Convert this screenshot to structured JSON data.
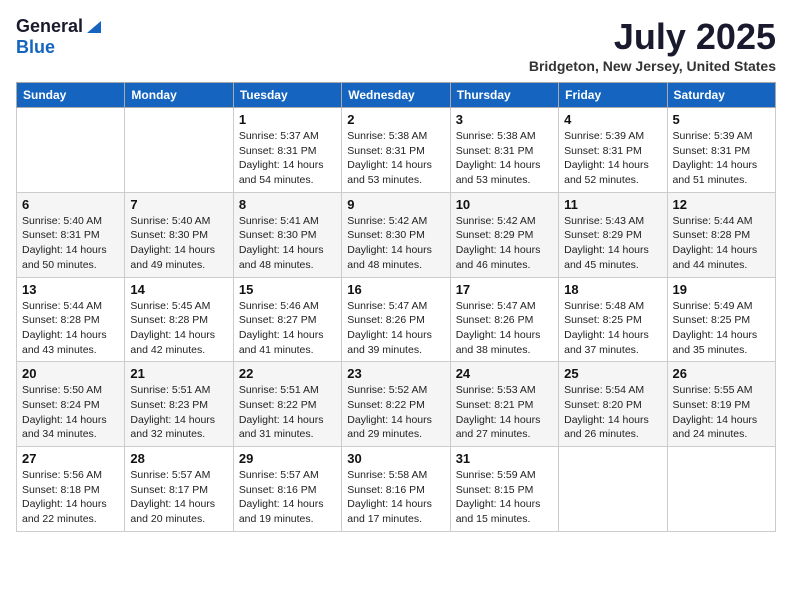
{
  "header": {
    "logo_general": "General",
    "logo_blue": "Blue",
    "title": "July 2025",
    "location": "Bridgeton, New Jersey, United States"
  },
  "weekdays": [
    "Sunday",
    "Monday",
    "Tuesday",
    "Wednesday",
    "Thursday",
    "Friday",
    "Saturday"
  ],
  "weeks": [
    [
      {
        "day": "",
        "sunrise": "",
        "sunset": "",
        "daylight": ""
      },
      {
        "day": "",
        "sunrise": "",
        "sunset": "",
        "daylight": ""
      },
      {
        "day": "1",
        "sunrise": "Sunrise: 5:37 AM",
        "sunset": "Sunset: 8:31 PM",
        "daylight": "Daylight: 14 hours and 54 minutes."
      },
      {
        "day": "2",
        "sunrise": "Sunrise: 5:38 AM",
        "sunset": "Sunset: 8:31 PM",
        "daylight": "Daylight: 14 hours and 53 minutes."
      },
      {
        "day": "3",
        "sunrise": "Sunrise: 5:38 AM",
        "sunset": "Sunset: 8:31 PM",
        "daylight": "Daylight: 14 hours and 53 minutes."
      },
      {
        "day": "4",
        "sunrise": "Sunrise: 5:39 AM",
        "sunset": "Sunset: 8:31 PM",
        "daylight": "Daylight: 14 hours and 52 minutes."
      },
      {
        "day": "5",
        "sunrise": "Sunrise: 5:39 AM",
        "sunset": "Sunset: 8:31 PM",
        "daylight": "Daylight: 14 hours and 51 minutes."
      }
    ],
    [
      {
        "day": "6",
        "sunrise": "Sunrise: 5:40 AM",
        "sunset": "Sunset: 8:31 PM",
        "daylight": "Daylight: 14 hours and 50 minutes."
      },
      {
        "day": "7",
        "sunrise": "Sunrise: 5:40 AM",
        "sunset": "Sunset: 8:30 PM",
        "daylight": "Daylight: 14 hours and 49 minutes."
      },
      {
        "day": "8",
        "sunrise": "Sunrise: 5:41 AM",
        "sunset": "Sunset: 8:30 PM",
        "daylight": "Daylight: 14 hours and 48 minutes."
      },
      {
        "day": "9",
        "sunrise": "Sunrise: 5:42 AM",
        "sunset": "Sunset: 8:30 PM",
        "daylight": "Daylight: 14 hours and 48 minutes."
      },
      {
        "day": "10",
        "sunrise": "Sunrise: 5:42 AM",
        "sunset": "Sunset: 8:29 PM",
        "daylight": "Daylight: 14 hours and 46 minutes."
      },
      {
        "day": "11",
        "sunrise": "Sunrise: 5:43 AM",
        "sunset": "Sunset: 8:29 PM",
        "daylight": "Daylight: 14 hours and 45 minutes."
      },
      {
        "day": "12",
        "sunrise": "Sunrise: 5:44 AM",
        "sunset": "Sunset: 8:28 PM",
        "daylight": "Daylight: 14 hours and 44 minutes."
      }
    ],
    [
      {
        "day": "13",
        "sunrise": "Sunrise: 5:44 AM",
        "sunset": "Sunset: 8:28 PM",
        "daylight": "Daylight: 14 hours and 43 minutes."
      },
      {
        "day": "14",
        "sunrise": "Sunrise: 5:45 AM",
        "sunset": "Sunset: 8:28 PM",
        "daylight": "Daylight: 14 hours and 42 minutes."
      },
      {
        "day": "15",
        "sunrise": "Sunrise: 5:46 AM",
        "sunset": "Sunset: 8:27 PM",
        "daylight": "Daylight: 14 hours and 41 minutes."
      },
      {
        "day": "16",
        "sunrise": "Sunrise: 5:47 AM",
        "sunset": "Sunset: 8:26 PM",
        "daylight": "Daylight: 14 hours and 39 minutes."
      },
      {
        "day": "17",
        "sunrise": "Sunrise: 5:47 AM",
        "sunset": "Sunset: 8:26 PM",
        "daylight": "Daylight: 14 hours and 38 minutes."
      },
      {
        "day": "18",
        "sunrise": "Sunrise: 5:48 AM",
        "sunset": "Sunset: 8:25 PM",
        "daylight": "Daylight: 14 hours and 37 minutes."
      },
      {
        "day": "19",
        "sunrise": "Sunrise: 5:49 AM",
        "sunset": "Sunset: 8:25 PM",
        "daylight": "Daylight: 14 hours and 35 minutes."
      }
    ],
    [
      {
        "day": "20",
        "sunrise": "Sunrise: 5:50 AM",
        "sunset": "Sunset: 8:24 PM",
        "daylight": "Daylight: 14 hours and 34 minutes."
      },
      {
        "day": "21",
        "sunrise": "Sunrise: 5:51 AM",
        "sunset": "Sunset: 8:23 PM",
        "daylight": "Daylight: 14 hours and 32 minutes."
      },
      {
        "day": "22",
        "sunrise": "Sunrise: 5:51 AM",
        "sunset": "Sunset: 8:22 PM",
        "daylight": "Daylight: 14 hours and 31 minutes."
      },
      {
        "day": "23",
        "sunrise": "Sunrise: 5:52 AM",
        "sunset": "Sunset: 8:22 PM",
        "daylight": "Daylight: 14 hours and 29 minutes."
      },
      {
        "day": "24",
        "sunrise": "Sunrise: 5:53 AM",
        "sunset": "Sunset: 8:21 PM",
        "daylight": "Daylight: 14 hours and 27 minutes."
      },
      {
        "day": "25",
        "sunrise": "Sunrise: 5:54 AM",
        "sunset": "Sunset: 8:20 PM",
        "daylight": "Daylight: 14 hours and 26 minutes."
      },
      {
        "day": "26",
        "sunrise": "Sunrise: 5:55 AM",
        "sunset": "Sunset: 8:19 PM",
        "daylight": "Daylight: 14 hours and 24 minutes."
      }
    ],
    [
      {
        "day": "27",
        "sunrise": "Sunrise: 5:56 AM",
        "sunset": "Sunset: 8:18 PM",
        "daylight": "Daylight: 14 hours and 22 minutes."
      },
      {
        "day": "28",
        "sunrise": "Sunrise: 5:57 AM",
        "sunset": "Sunset: 8:17 PM",
        "daylight": "Daylight: 14 hours and 20 minutes."
      },
      {
        "day": "29",
        "sunrise": "Sunrise: 5:57 AM",
        "sunset": "Sunset: 8:16 PM",
        "daylight": "Daylight: 14 hours and 19 minutes."
      },
      {
        "day": "30",
        "sunrise": "Sunrise: 5:58 AM",
        "sunset": "Sunset: 8:16 PM",
        "daylight": "Daylight: 14 hours and 17 minutes."
      },
      {
        "day": "31",
        "sunrise": "Sunrise: 5:59 AM",
        "sunset": "Sunset: 8:15 PM",
        "daylight": "Daylight: 14 hours and 15 minutes."
      },
      {
        "day": "",
        "sunrise": "",
        "sunset": "",
        "daylight": ""
      },
      {
        "day": "",
        "sunrise": "",
        "sunset": "",
        "daylight": ""
      }
    ]
  ]
}
